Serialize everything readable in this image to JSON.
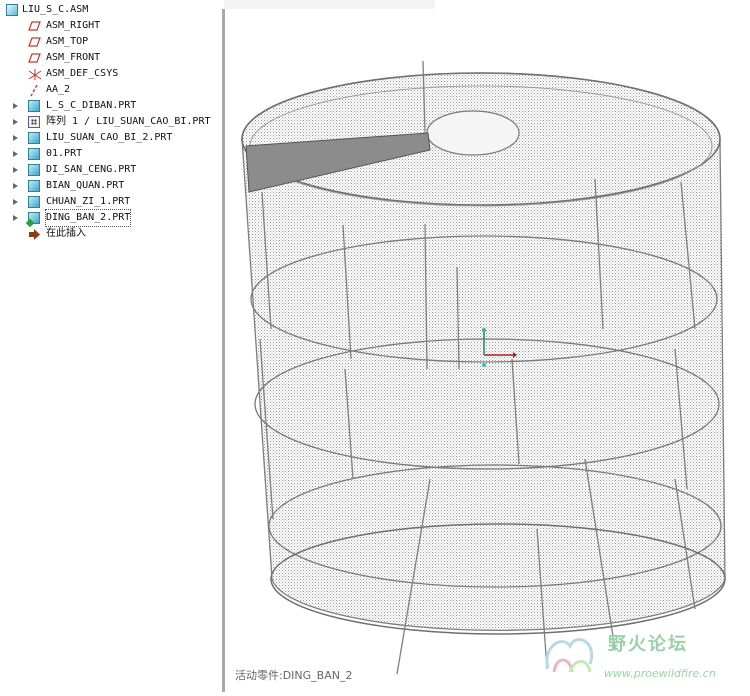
{
  "model_tree": {
    "root": {
      "label": "LIU_S_C.ASM",
      "icon": "assembly-icon"
    },
    "items": [
      {
        "label": "ASM_RIGHT",
        "icon": "datum-plane-icon"
      },
      {
        "label": "ASM_TOP",
        "icon": "datum-plane-icon"
      },
      {
        "label": "ASM_FRONT",
        "icon": "datum-plane-icon"
      },
      {
        "label": "ASM_DEF_CSYS",
        "icon": "coordinate-system-icon"
      },
      {
        "label": "AA_2",
        "icon": "datum-axis-icon"
      },
      {
        "label": "L_S_C_DIBAN.PRT",
        "icon": "part-icon"
      },
      {
        "label": "阵列 1 / LIU_SUAN_CAO_BI.PRT",
        "icon": "pattern-icon"
      },
      {
        "label": "LIU_SUAN_CAO_BI_2.PRT",
        "icon": "part-icon"
      },
      {
        "label": "01.PRT",
        "icon": "part-icon"
      },
      {
        "label": "DI_SAN_CENG.PRT",
        "icon": "part-icon"
      },
      {
        "label": "BIAN_QUAN.PRT",
        "icon": "part-icon"
      },
      {
        "label": "CHUAN_ZI_1.PRT",
        "icon": "part-icon"
      },
      {
        "label": "DING_BAN_2.PRT",
        "icon": "part-icon"
      },
      {
        "label": "在此插入",
        "icon": "insert-here-arrow-icon"
      }
    ]
  },
  "status": {
    "active_part": "活动零件:DING_BAN_2"
  },
  "watermark": {
    "title": "野火论坛",
    "url": "www.proewildfire.cn"
  },
  "colors": {
    "mesh": "#8a8a8a",
    "wedge": "#8c8c8c",
    "divider": "#a9a9a9",
    "watermark": "#9bd2a8"
  }
}
